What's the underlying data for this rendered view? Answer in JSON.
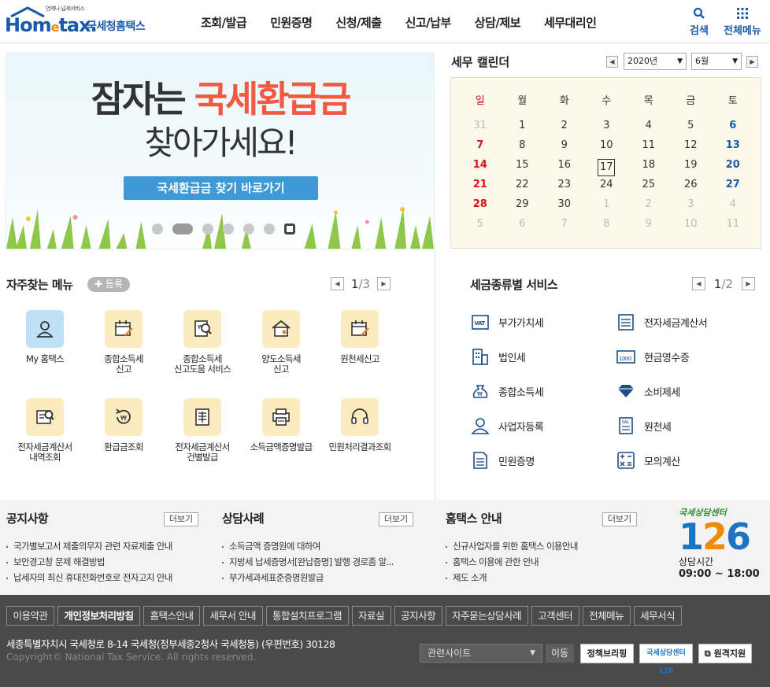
{
  "header": {
    "logo_tag": "언제나 납세서비스",
    "logo_brand_a": "Hom",
    "logo_brand_e": "e",
    "logo_brand_b": "tax.",
    "logo_kr": "국세청홈택스",
    "menus": [
      "조회/발급",
      "민원증명",
      "신청/제출",
      "신고/납부",
      "상담/제보",
      "세무대리인"
    ],
    "search_label": "검색",
    "allmenu_label": "전체메뉴"
  },
  "banner": {
    "line1_pre": "잠자는 ",
    "line1_highlight": "국세환급금",
    "line2": "찾아가세요!",
    "cta": "국세환급금 찾기 바로가기"
  },
  "calendar": {
    "title": "세무 캘린더",
    "year": "2020년",
    "month": "6월",
    "weekdays": [
      "일",
      "월",
      "화",
      "수",
      "목",
      "금",
      "토"
    ],
    "weeks": [
      [
        "31",
        "1",
        "2",
        "3",
        "4",
        "5",
        "6"
      ],
      [
        "7",
        "8",
        "9",
        "10",
        "11",
        "12",
        "13"
      ],
      [
        "14",
        "15",
        "16",
        "17",
        "18",
        "19",
        "20"
      ],
      [
        "21",
        "22",
        "23",
        "24",
        "25",
        "26",
        "27"
      ],
      [
        "28",
        "29",
        "30",
        "1",
        "2",
        "3",
        "4"
      ],
      [
        "5",
        "6",
        "7",
        "8",
        "9",
        "10",
        "11"
      ]
    ],
    "today": "17"
  },
  "frequent": {
    "title": "자주찾는 메뉴",
    "register": "등록",
    "page_current": "1",
    "page_total": "/3",
    "items": [
      {
        "label1": "My 홈택스",
        "label2": ""
      },
      {
        "label1": "종합소득세",
        "label2": "신고"
      },
      {
        "label1": "종합소득세",
        "label2": "신고도움 서비스"
      },
      {
        "label1": "양도소득세",
        "label2": "신고"
      },
      {
        "label1": "원천세신고",
        "label2": ""
      },
      {
        "label1": "전자세금계산서",
        "label2": "내역조회"
      },
      {
        "label1": "환급금조회",
        "label2": ""
      },
      {
        "label1": "전자세금계산서",
        "label2": "건별발급"
      },
      {
        "label1": "소득금액증명발급",
        "label2": ""
      },
      {
        "label1": "민원처리결과조회",
        "label2": ""
      }
    ]
  },
  "taxservice": {
    "title": "세금종류별 서비스",
    "page_current": "1",
    "page_total": "/2",
    "items": [
      "부가가치세",
      "전자세금계산서",
      "법인세",
      "현금영수증",
      "종합소득세",
      "소비제세",
      "사업자등록",
      "원천세",
      "민원증명",
      "모의계산"
    ]
  },
  "boards": {
    "notice": {
      "title": "공지사항",
      "more": "더보기",
      "items": [
        "국가별보고서 제출의무자 관련 자료제출 안내",
        "보안경고창 문제 해결방법",
        "납세자의 최신 휴대전화번호로 전자고지 안내"
      ]
    },
    "consult": {
      "title": "상담사례",
      "more": "더보기",
      "items": [
        "소득금액 증명원에 대하여",
        "지방세 납세증명서[완납증명] 발행 경로좀 알...",
        "부가세과세표준증명원발급"
      ]
    },
    "guide": {
      "title": "홈택스 안내",
      "more": "더보기",
      "items": [
        "신규사업자를 위한 홈택스 이용안내",
        "홈택스 이용에 관한 안내",
        "제도 소개"
      ]
    },
    "center": {
      "title": "국세상담센터",
      "num_a": "1",
      "num_b": "2",
      "num_c": "6",
      "hours_label": "상담시간",
      "hours": "09:00 ~ 18:00"
    }
  },
  "footer": {
    "menus": [
      "이용약관",
      "개인정보처리방침",
      "홈택스안내",
      "세무서 안내",
      "통합설치프로그램",
      "자료실",
      "공지사항",
      "자주묻는상담사례",
      "고객센터",
      "전체메뉴",
      "세무서식"
    ],
    "address": "세종특별자치시 국세청로 8-14 국세청(정부세종2청사 국세청동) (우편번호) 30128",
    "copyright": "Copyright© National Tax Service. All rights reserved.",
    "related_sites": "관련사이트",
    "go": "이동",
    "btn_policy": "정책브리핑",
    "btn_126": "국세상담센터 126",
    "btn_remote": "원격지원"
  }
}
